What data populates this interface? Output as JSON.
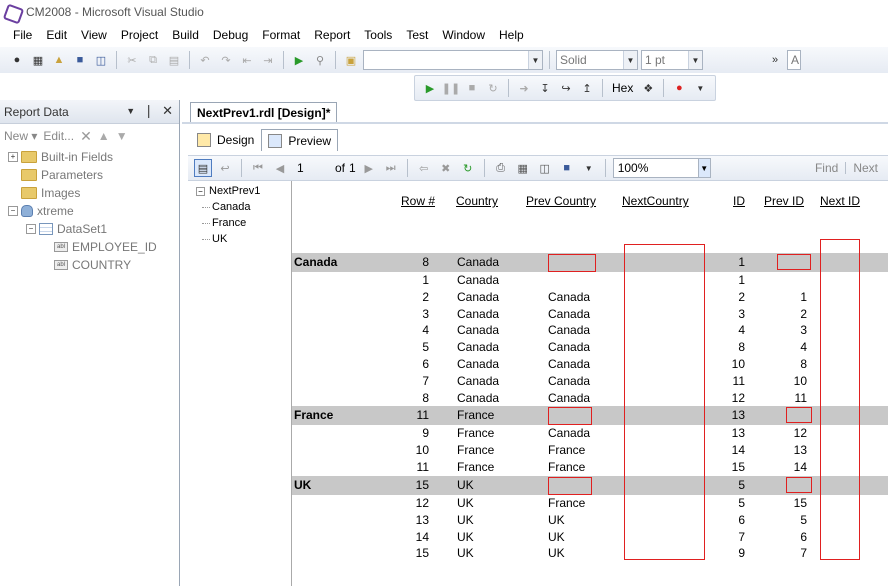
{
  "window": {
    "title": "CM2008 - Microsoft Visual Studio"
  },
  "menu": [
    "File",
    "Edit",
    "View",
    "Project",
    "Build",
    "Debug",
    "Format",
    "Report",
    "Tools",
    "Test",
    "Window",
    "Help"
  ],
  "format_toolbar": {
    "line_style": "Solid",
    "line_width": "1 pt",
    "font_box": "A"
  },
  "debug_toolbar": {
    "hex_label": "Hex"
  },
  "report_data_panel": {
    "title": "Report Data",
    "new_label": "New",
    "edit_label": "Edit...",
    "tree": {
      "builtin_fields": "Built-in Fields",
      "parameters": "Parameters",
      "images": "Images",
      "datasource": "xtreme",
      "dataset": "DataSet1",
      "fields": [
        "EMPLOYEE_ID",
        "COUNTRY"
      ]
    }
  },
  "document_tab": {
    "label": "NextPrev1.rdl [Design]*"
  },
  "view_tabs": {
    "design": "Design",
    "preview": "Preview"
  },
  "preview_toolbar": {
    "page": "1",
    "of_label": "of",
    "total_pages": "1",
    "zoom": "100%",
    "find_label": "Find",
    "next_label": "Next"
  },
  "document_map": {
    "root": "NextPrev1",
    "items": [
      "Canada",
      "France",
      "UK"
    ]
  },
  "colors": {
    "highlight_box": "#e02020",
    "group_band": "#c8c8c8"
  },
  "report": {
    "headers": {
      "row_num": "Row #",
      "country": "Country",
      "prev_country": "Prev Country",
      "next_country": "NextCountry",
      "id": "ID",
      "prev_id": "Prev ID",
      "next_id": "Next ID"
    },
    "groups": [
      {
        "name": "Canada",
        "header": {
          "row": "8",
          "country": "Canada",
          "id": "1"
        },
        "rows": [
          {
            "row": "1",
            "country": "Canada",
            "prev_country": "",
            "id": "1",
            "prev_id": ""
          },
          {
            "row": "2",
            "country": "Canada",
            "prev_country": "Canada",
            "id": "2",
            "prev_id": "1"
          },
          {
            "row": "3",
            "country": "Canada",
            "prev_country": "Canada",
            "id": "3",
            "prev_id": "2"
          },
          {
            "row": "4",
            "country": "Canada",
            "prev_country": "Canada",
            "id": "4",
            "prev_id": "3"
          },
          {
            "row": "5",
            "country": "Canada",
            "prev_country": "Canada",
            "id": "8",
            "prev_id": "4"
          },
          {
            "row": "6",
            "country": "Canada",
            "prev_country": "Canada",
            "id": "10",
            "prev_id": "8"
          },
          {
            "row": "7",
            "country": "Canada",
            "prev_country": "Canada",
            "id": "11",
            "prev_id": "10"
          },
          {
            "row": "8",
            "country": "Canada",
            "prev_country": "Canada",
            "id": "12",
            "prev_id": "11"
          }
        ]
      },
      {
        "name": "France",
        "header": {
          "row": "11",
          "country": "France",
          "id": "13"
        },
        "rows": [
          {
            "row": "9",
            "country": "France",
            "prev_country": "Canada",
            "id": "13",
            "prev_id": "12"
          },
          {
            "row": "10",
            "country": "France",
            "prev_country": "France",
            "id": "14",
            "prev_id": "13"
          },
          {
            "row": "11",
            "country": "France",
            "prev_country": "France",
            "id": "15",
            "prev_id": "14"
          }
        ]
      },
      {
        "name": "UK",
        "header": {
          "row": "15",
          "country": "UK",
          "id": "5"
        },
        "rows": [
          {
            "row": "12",
            "country": "UK",
            "prev_country": "France",
            "id": "5",
            "prev_id": "15"
          },
          {
            "row": "13",
            "country": "UK",
            "prev_country": "UK",
            "id": "6",
            "prev_id": "5"
          },
          {
            "row": "14",
            "country": "UK",
            "prev_country": "UK",
            "id": "7",
            "prev_id": "6"
          },
          {
            "row": "15",
            "country": "UK",
            "prev_country": "UK",
            "id": "9",
            "prev_id": "7"
          }
        ]
      }
    ]
  }
}
